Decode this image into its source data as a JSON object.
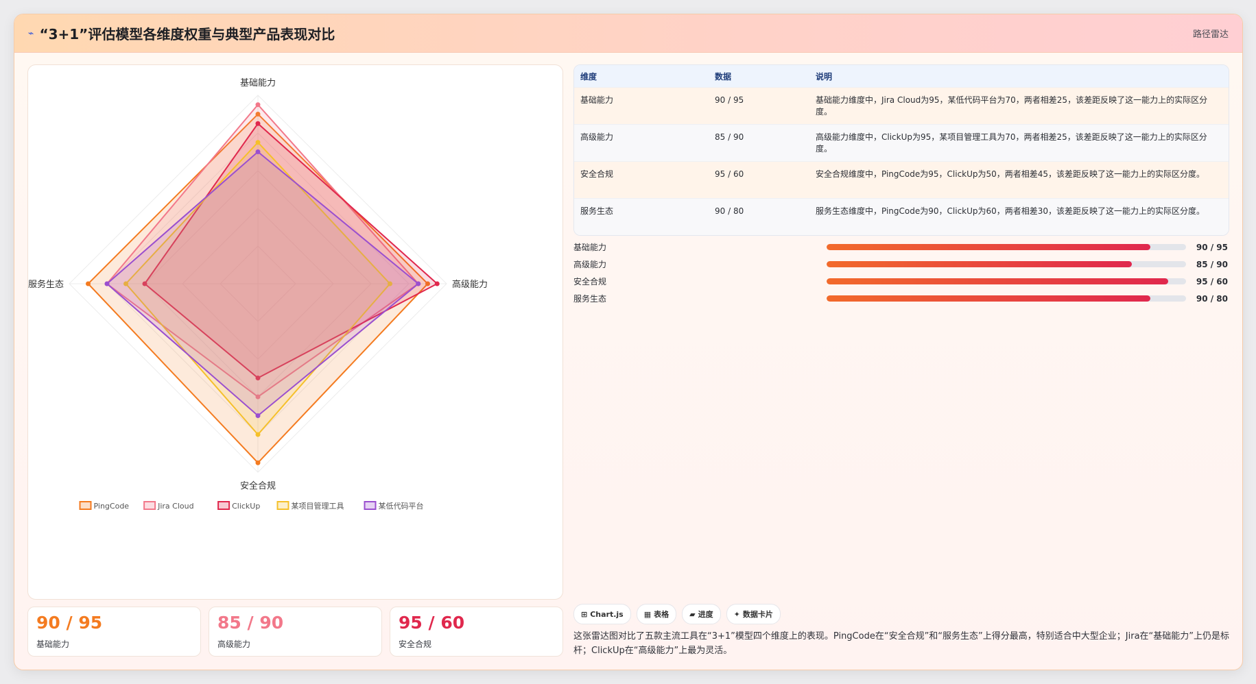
{
  "header": {
    "title": "“3+1”评估模型各维度权重与典型产品表现对比",
    "tag": "路径雷达",
    "icon": "chart-icon"
  },
  "chart_data": {
    "type": "radar",
    "axes": [
      "基础能力",
      "高级能力",
      "安全合规",
      "服务生态"
    ],
    "rmax": 100,
    "grid_levels": 5,
    "series": [
      {
        "name": "PingCode",
        "values": [
          90,
          90,
          95,
          90
        ],
        "color": "#f47b20"
      },
      {
        "name": "Jira Cloud",
        "values": [
          95,
          85,
          60,
          80
        ],
        "color": "#f2788a"
      },
      {
        "name": "ClickUp",
        "values": [
          85,
          95,
          50,
          60
        ],
        "color": "#e0284d"
      },
      {
        "name": "某项目管理工具",
        "values": [
          75,
          70,
          80,
          70
        ],
        "color": "#f5c02a"
      },
      {
        "name": "某低代码平台",
        "values": [
          70,
          85,
          70,
          80
        ],
        "color": "#9a4fcf"
      }
    ],
    "legend": "bottom"
  },
  "table": {
    "headers": [
      "维度",
      "数据",
      "说明"
    ],
    "rows": [
      {
        "dim": "基础能力",
        "data": "90 / 95",
        "desc": "基础能力维度中，Jira Cloud为95，某低代码平台为70，两者相差25，该差距反映了这一能力上的实际区分度。"
      },
      {
        "dim": "高级能力",
        "data": "85 / 90",
        "desc": "高级能力维度中，ClickUp为95，某项目管理工具为70，两者相差25，该差距反映了这一能力上的实际区分度。"
      },
      {
        "dim": "安全合规",
        "data": "95 / 60",
        "desc": "安全合规维度中，PingCode为95，ClickUp为50，两者相差45，该差距反映了这一能力上的实际区分度。"
      },
      {
        "dim": "服务生态",
        "data": "90 / 80",
        "desc": "服务生态维度中，PingCode为90，ClickUp为60，两者相差30，该差距反映了这一能力上的实际区分度。"
      }
    ]
  },
  "bars": [
    {
      "label": "基础能力",
      "value": "90 / 95",
      "percent": 90
    },
    {
      "label": "高级能力",
      "value": "85 / 90",
      "percent": 85
    },
    {
      "label": "安全合规",
      "value": "95 / 60",
      "percent": 95
    },
    {
      "label": "服务生态",
      "value": "90 / 80",
      "percent": 90
    }
  ],
  "stats": [
    {
      "value": "90 / 95",
      "label": "基础能力",
      "color": "#f47b20"
    },
    {
      "value": "85 / 90",
      "label": "高级能力",
      "color": "#f2788a"
    },
    {
      "value": "95 / 60",
      "label": "安全合规",
      "color": "#e0284d"
    }
  ],
  "chips": [
    {
      "label": "Chart.js",
      "icon": "grid-icon",
      "glyph": "⊞"
    },
    {
      "label": "表格",
      "icon": "table-icon",
      "glyph": "▦"
    },
    {
      "label": "进度",
      "icon": "progress-icon",
      "glyph": "▰"
    },
    {
      "label": "数据卡片",
      "icon": "sparkle-icon",
      "glyph": "✦"
    }
  ],
  "summary": "这张雷达图对比了五款主流工具在“3+1”模型四个维度上的表现。PingCode在“安全合规”和“服务生态”上得分最高，特别适合中大型企业；Jira在“基础能力”上仍是标杆；ClickUp在“高级能力”上最为灵活。"
}
